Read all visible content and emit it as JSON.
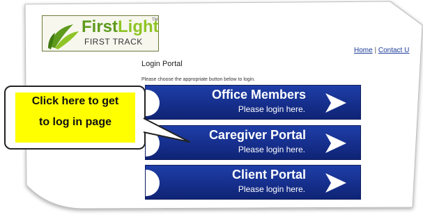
{
  "logo": {
    "first": "First",
    "light": "Light",
    "tm": "TM",
    "subtitle": "FIRST TRACK"
  },
  "nav": {
    "home": "Home",
    "separator": "|",
    "contact": "Contact U"
  },
  "portal": {
    "title": "Login Portal",
    "instructions": "Please choose the appropriate button below to login."
  },
  "buttons": [
    {
      "title": "Office Members",
      "subtitle": "Please login here."
    },
    {
      "title": "Caregiver Portal",
      "subtitle": "Please login here."
    },
    {
      "title": "Client Portal",
      "subtitle": "Please login here."
    }
  ],
  "callout": {
    "line1": "Click here to get",
    "line2": "to log in page"
  },
  "colors": {
    "button_blue": "#1a3a9a",
    "callout_highlight": "#ffff00",
    "logo_green": "#5e9a1c",
    "link_blue": "#1a3a9a"
  }
}
